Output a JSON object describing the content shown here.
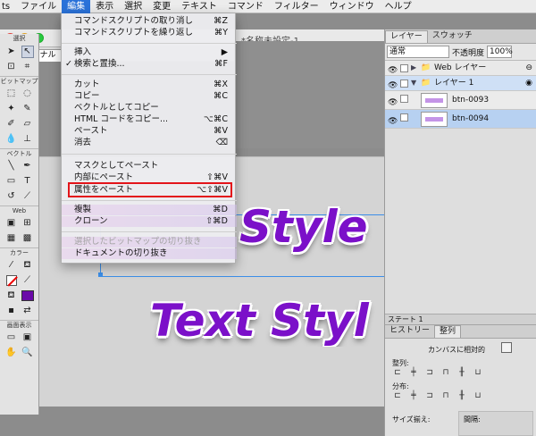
{
  "menubar": {
    "items": [
      "ts",
      "ファイル",
      "編集",
      "表示",
      "選択",
      "変更",
      "テキスト",
      "コマンド",
      "フィルター",
      "ウィンドウ",
      "ヘルプ"
    ],
    "active_index": 2
  },
  "edit_menu": {
    "items": [
      {
        "label": "コマンドスクリプトの取り消し",
        "shortcut": "⌘Z"
      },
      {
        "label": "コマンドスクリプトを繰り返し",
        "shortcut": "⌘Y"
      },
      {
        "label": "挿入",
        "shortcut": "▶"
      },
      {
        "label": "検索と置換...",
        "shortcut": "⌘F",
        "checked": "✓"
      },
      {
        "label": "カット",
        "shortcut": "⌘X"
      },
      {
        "label": "コピー",
        "shortcut": "⌘C"
      },
      {
        "label": "ベクトルとしてコピー",
        "shortcut": ""
      },
      {
        "label": "HTML コードをコピー...",
        "shortcut": "⌥⌘C"
      },
      {
        "label": "ペースト",
        "shortcut": "⌘V"
      },
      {
        "label": "消去",
        "shortcut": "⌫"
      },
      {
        "label": "マスクとしてペースト",
        "shortcut": ""
      },
      {
        "label": "内部にペースト",
        "shortcut": "⇧⌘V"
      },
      {
        "label": "属性をペースト",
        "shortcut": "⌥⇧⌘V"
      },
      {
        "label": "複製",
        "shortcut": "⌘D"
      },
      {
        "label": "クローン",
        "shortcut": "⇧⌘D"
      },
      {
        "label": "選択したビットマップの切り抜き",
        "shortcut": ""
      },
      {
        "label": "ドキュメントの切り抜き",
        "shortcut": ""
      }
    ],
    "highlighted_index": 12
  },
  "document": {
    "title": "*名称未設定-1",
    "tab_label": "オリジナル",
    "tab_fragment": "ウ",
    "canvas_text_1": "Style",
    "canvas_text_2": "Text Styl"
  },
  "tools": {
    "sections": [
      "選択",
      "ビットマップ",
      "ベクトル",
      "Web",
      "カラー",
      "画面表示"
    ]
  },
  "layers_panel": {
    "tabs": [
      "レイヤー",
      "スウォッチ"
    ],
    "blend_mode": "通常",
    "opacity_label": "不透明度",
    "opacity_value": "100%",
    "rows": [
      {
        "name": "Web レイヤー"
      },
      {
        "name": "レイヤー 1"
      },
      {
        "name": "btn-0093"
      },
      {
        "name": "btn-0094"
      }
    ],
    "footer": "ステート 1"
  },
  "align_panel": {
    "tabs": [
      "ヒストリー",
      "整列"
    ],
    "relative_label": "カンバスに相対的",
    "align_label": "整列:",
    "distribute_label": "分布:",
    "size_label": "サイズ揃え:",
    "spacing_label": "間隔:"
  },
  "colors": {
    "menu_active": "#2a72d9",
    "highlight_border": "#e3141a",
    "text_style_purple": "#7b10c9",
    "layer_selected": "#b7d1f1"
  }
}
